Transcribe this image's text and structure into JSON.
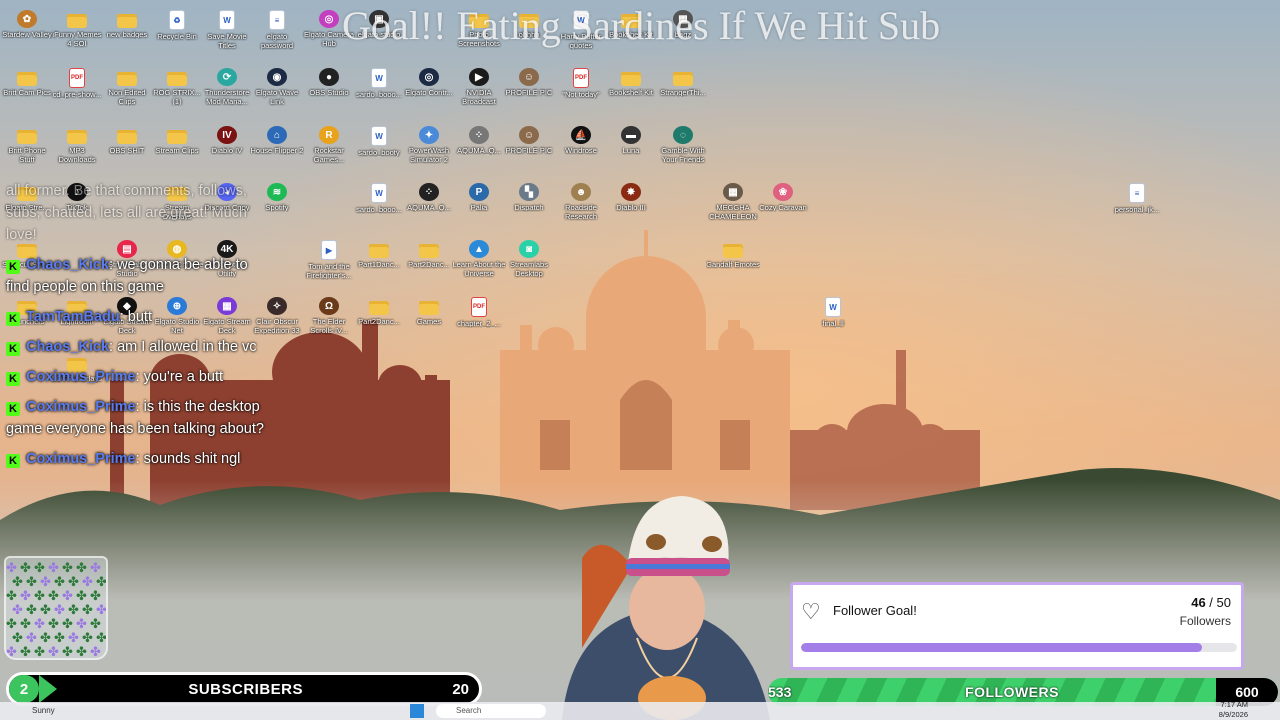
{
  "stream_title": "Goal!! Eating Sardines If We Hit Sub",
  "desktop_icons": [
    {
      "label": "Stardew Valley",
      "kind": "app",
      "color": "#c07a2c",
      "glyph": "✿"
    },
    {
      "label": "iFunny Memes 4 SOI",
      "kind": "folder"
    },
    {
      "label": "new badges",
      "kind": "folder"
    },
    {
      "label": "Recycle Bin",
      "kind": "doc",
      "glyph": "♻"
    },
    {
      "label": "Save Movie Titles",
      "kind": "doc",
      "glyph": "W"
    },
    {
      "label": "elgato password",
      "kind": "doc",
      "glyph": "≡"
    },
    {
      "label": "Elgato Camera Hub",
      "kind": "app",
      "color": "#c43fbf",
      "glyph": "◎"
    },
    {
      "label": "elgato studio",
      "kind": "app",
      "color": "#333",
      "glyph": "▣"
    },
    {
      "label": "Photo Screenshots",
      "kind": "folder"
    },
    {
      "label": "ohhhh",
      "kind": "folder"
    },
    {
      "label": "Harry Potter quotes",
      "kind": "doc",
      "glyph": "W"
    },
    {
      "label": "Bookshelf Kit",
      "kind": "folder"
    },
    {
      "label": "bagz",
      "kind": "app",
      "color": "#555",
      "glyph": "▦"
    },
    {
      "label": "Britt Cam Pics",
      "kind": "folder"
    },
    {
      "label": "cd_pre-show...",
      "kind": "pdf",
      "glyph": "PDF"
    },
    {
      "label": "Non Edited Clips",
      "kind": "folder"
    },
    {
      "label": "ROG STRIX... (1)",
      "kind": "folder"
    },
    {
      "label": "Thunderstore Mod Mana...",
      "kind": "app",
      "color": "#2aa8a0",
      "glyph": "⟳"
    },
    {
      "label": "Elgato Wave Link",
      "kind": "app",
      "color": "#1c2a44",
      "glyph": "◉"
    },
    {
      "label": "OBS Studio",
      "kind": "app",
      "color": "#222",
      "glyph": "●"
    },
    {
      "label": "sardo_booo...",
      "kind": "doc",
      "glyph": "W"
    },
    {
      "label": "Elgato Contr...",
      "kind": "app",
      "color": "#1c2a44",
      "glyph": "◎"
    },
    {
      "label": "NVIDIA Broadcast",
      "kind": "app",
      "color": "#1a1a1a",
      "glyph": "▶"
    },
    {
      "label": "PROFILE PIC",
      "kind": "app",
      "color": "#8a6a4a",
      "glyph": "☺"
    },
    {
      "label": "\"Not today\"",
      "kind": "pdf",
      "glyph": "PDF"
    },
    {
      "label": "Bookshelf Kit",
      "kind": "folder"
    },
    {
      "label": "StrangerThi...",
      "kind": "folder"
    },
    {
      "label": "Britt Phone Stuff",
      "kind": "folder"
    },
    {
      "label": "MP3 Downloads",
      "kind": "folder"
    },
    {
      "label": "OBS SHIT",
      "kind": "folder"
    },
    {
      "label": "Stream Clips",
      "kind": "folder"
    },
    {
      "label": "Diablo IV",
      "kind": "app",
      "color": "#7a1212",
      "glyph": "IV"
    },
    {
      "label": "House Flipper 2",
      "kind": "app",
      "color": "#2c6ab8",
      "glyph": "⌂"
    },
    {
      "label": "Rockstar Games...",
      "kind": "app",
      "color": "#e8a21c",
      "glyph": "R"
    },
    {
      "label": "sardo_booty",
      "kind": "doc",
      "glyph": "W"
    },
    {
      "label": "PowerWash Simulator 2",
      "kind": "app",
      "color": "#4a8ad8",
      "glyph": "✦"
    },
    {
      "label": "AQUMA_Q...",
      "kind": "app",
      "color": "#777",
      "glyph": "⁘"
    },
    {
      "label": "PROFILE PIC",
      "kind": "app",
      "color": "#8a6a4a",
      "glyph": "☺"
    },
    {
      "label": "Windrose",
      "kind": "app",
      "color": "#111",
      "glyph": "⛵"
    },
    {
      "label": "Luna",
      "kind": "app",
      "color": "#333",
      "glyph": "▬"
    },
    {
      "label": "Gamble With Your Friends",
      "kind": "app",
      "color": "#1e7a6a",
      "glyph": "◌"
    },
    {
      "label": "Elgato Stre...",
      "kind": "folder"
    },
    {
      "label": "TikTok",
      "kind": "app",
      "color": "#111",
      "glyph": "♪"
    },
    {
      "label": "Stream Overlays",
      "kind": "folder"
    },
    {
      "label": "Discord Copy",
      "kind": "app",
      "color": "#5865f2",
      "glyph": "◕"
    },
    {
      "label": "Spotify",
      "kind": "app",
      "color": "#1db954",
      "glyph": "≋"
    },
    {
      "label": "sardo_booo...",
      "kind": "doc",
      "glyph": "W"
    },
    {
      "label": "AQUMA_Q...",
      "kind": "app",
      "color": "#222",
      "glyph": "⁘"
    },
    {
      "label": "Palia",
      "kind": "app",
      "color": "#2a6aa8",
      "glyph": "P"
    },
    {
      "label": "Dispatch",
      "kind": "app",
      "color": "#6a7a8a",
      "glyph": "▚"
    },
    {
      "label": "Roadside Research",
      "kind": "app",
      "color": "#a08050",
      "glyph": "☻"
    },
    {
      "label": "Diablo III",
      "kind": "app",
      "color": "#8a2a12",
      "glyph": "✸"
    },
    {
      "label": "MEGGHA CHAMELEON",
      "kind": "app",
      "color": "#6a5a4a",
      "glyph": "▦"
    },
    {
      "label": "Cozy Caravan",
      "kind": "app",
      "color": "#e06080",
      "glyph": "❀"
    },
    {
      "label": "personal_jk...",
      "kind": "doc",
      "glyph": "≡"
    },
    {
      "label": "Shortcut Stre...",
      "kind": "folder"
    },
    {
      "label": "Streamlabs Studio",
      "kind": "app",
      "color": "#e8254a",
      "glyph": "▤"
    },
    {
      "label": "Google Chrome",
      "kind": "app",
      "color": "#e8b820",
      "glyph": "◍"
    },
    {
      "label": "4K Capture Utility",
      "kind": "app",
      "color": "#1a1a1a",
      "glyph": "4K"
    },
    {
      "label": "Tom and the Firefighter's...",
      "kind": "doc",
      "glyph": "▶"
    },
    {
      "label": "Part1Danc...",
      "kind": "folder"
    },
    {
      "label": "Part2Danc...",
      "kind": "folder"
    },
    {
      "label": "Learn About the Universe",
      "kind": "app",
      "color": "#2a8ad8",
      "glyph": "▲"
    },
    {
      "label": "Streamlabs Desktop",
      "kind": "app",
      "color": "#2ad0a8",
      "glyph": "◙"
    },
    {
      "label": "Gandalf Emotes",
      "kind": "folder"
    },
    {
      "label": "Launchers",
      "kind": "folder"
    },
    {
      "label": "Lightroom",
      "kind": "folder"
    },
    {
      "label": "Elgato Stream Deck",
      "kind": "app",
      "color": "#111",
      "glyph": "◆"
    },
    {
      "label": "Elgato Studio Net",
      "kind": "app",
      "color": "#2a7ad8",
      "glyph": "⊕"
    },
    {
      "label": "Elgato Stream Deck",
      "kind": "app",
      "color": "#7a3ad8",
      "glyph": "▦"
    },
    {
      "label": "Clair Obscur Expedition 33",
      "kind": "app",
      "color": "#3a2a2a",
      "glyph": "✧"
    },
    {
      "label": "The Elder Scrolls IV...",
      "kind": "app",
      "color": "#6a3a1a",
      "glyph": "Ω"
    },
    {
      "label": "Part2Danc...",
      "kind": "folder"
    },
    {
      "label": "Games",
      "kind": "folder"
    },
    {
      "label": "chapter_2_...",
      "kind": "pdf",
      "glyph": "PDF"
    },
    {
      "label": "final_ll",
      "kind": "doc",
      "glyph": "W"
    },
    {
      "label": "LOTR overlays",
      "kind": "folder"
    }
  ],
  "chat": {
    "messages": [
      {
        "user": "",
        "text": "all former. Be that comments, follows, subs, chatted, lets all are great! Much love!",
        "faded": true,
        "badge": false
      },
      {
        "user": "Chaos_Kick",
        "text": "we gonna be able to find people on this game",
        "faded": false,
        "badge": true,
        "color": "#5a7cf0"
      },
      {
        "user": "TamTamBadu",
        "text": "butt",
        "faded": false,
        "badge": true,
        "color": "#5a7cf0"
      },
      {
        "user": "Chaos_Kick",
        "text": "am I allowed in the vc",
        "faded": false,
        "badge": true,
        "color": "#5a7cf0"
      },
      {
        "user": "Coximus_Prime",
        "text": "you're a butt",
        "faded": false,
        "badge": true,
        "color": "#5a7cf0"
      },
      {
        "user": "Coximus_Prime",
        "text": "is this the desktop game everyone has been talking about?",
        "faded": false,
        "badge": true,
        "color": "#5a7cf0"
      },
      {
        "user": "Coximus_Prime",
        "text": "sounds shit ngl",
        "faded": false,
        "badge": true,
        "color": "#5a7cf0"
      }
    ],
    "kick_glyph": "K"
  },
  "subs_bar": {
    "current": "2",
    "label": "SUBSCRIBERS",
    "goal": "20"
  },
  "follower_goal": {
    "title": "Follower Goal!",
    "current": "46",
    "separator": " / ",
    "target": "50",
    "unit": "Followers",
    "progress": 0.92
  },
  "followers_bar": {
    "left": "533",
    "label": "FOLLOWERS",
    "right": "600"
  },
  "taskbar": {
    "weather": "Sunny",
    "search": "Search",
    "time": "7:17 AM",
    "date": "8/9/2026"
  },
  "colors": {
    "kick_green": "#53fc18",
    "username": "#5a7cf0",
    "goal_purple": "#a37ee8"
  }
}
